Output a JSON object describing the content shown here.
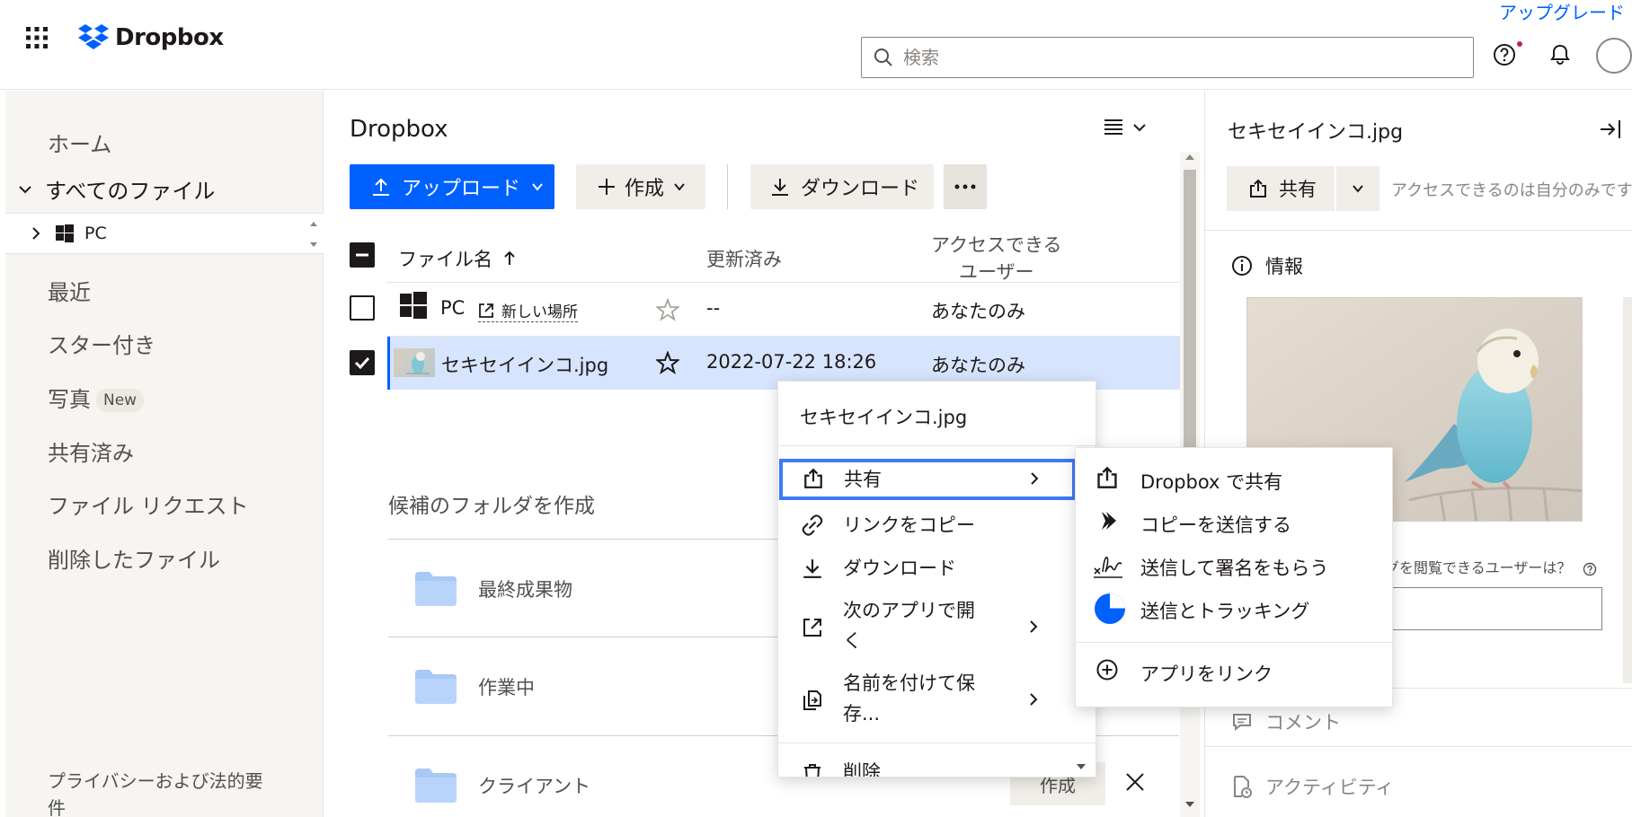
{
  "topbar": {
    "logo_text": "Dropbox",
    "upgrade_label": "アップグレード",
    "search_placeholder": "検索"
  },
  "sidebar": {
    "home": "ホーム",
    "all_files": "すべてのファイル",
    "tree_pc": "PC",
    "recent": "最近",
    "starred": "スター付き",
    "photos": "写真",
    "photos_badge": "New",
    "shared": "共有済み",
    "file_requests": "ファイル リクエスト",
    "deleted": "削除したファイル",
    "privacy_line1": "プライバシーおよび法的要",
    "privacy_line2": "件"
  },
  "main": {
    "title": "Dropbox",
    "upload_label": "アップロード",
    "create_label": "作成",
    "download_label": "ダウンロード",
    "columns": {
      "name": "ファイル名",
      "modified": "更新済み",
      "access_line1": "アクセスできる",
      "access_line2": "ユーザー"
    },
    "rows": [
      {
        "name": "PC",
        "tag": "新しい場所",
        "modified": "--",
        "access": "あなたのみ",
        "checked": false
      },
      {
        "name": "セキセイインコ.jpg",
        "modified": "2022-07-22 18:26",
        "access": "あなたのみ",
        "checked": true
      }
    ],
    "suggest_title": "候補のフォルダを作成",
    "folders": [
      "最終成果物",
      "作業中",
      "クライアント"
    ],
    "create_folder_label": "作成"
  },
  "right_panel": {
    "title": "セキセイインコ.jpg",
    "share_label": "共有",
    "access_text": "アクセスできるのは自分のみです",
    "info_label": "情報",
    "viewers_text": "グを閲覧できるユーザーは？",
    "comment_label": "コメント",
    "activity_label": "アクティビティ"
  },
  "context_menu": {
    "title": "セキセイインコ.jpg",
    "items": [
      {
        "label": "共有"
      },
      {
        "label": "リンクをコピー"
      },
      {
        "label": "ダウンロード"
      },
      {
        "label_line1": "次のアプリで開",
        "label_line2": "く"
      },
      {
        "label_line1": "名前を付けて保",
        "label_line2": "存..."
      },
      {
        "label": "削除"
      }
    ]
  },
  "share_submenu": {
    "items": [
      {
        "label": "Dropbox で共有"
      },
      {
        "label": "コピーを送信する"
      },
      {
        "label": "送信して署名をもらう"
      },
      {
        "label": "送信とトラッキング"
      },
      {
        "label": "アプリをリンク"
      }
    ]
  },
  "colors": {
    "accent": "#0061fe",
    "selected_row": "#d6e4fd",
    "focus_ring": "#3e79f7",
    "sidebar_bg": "#f7f5f2"
  }
}
